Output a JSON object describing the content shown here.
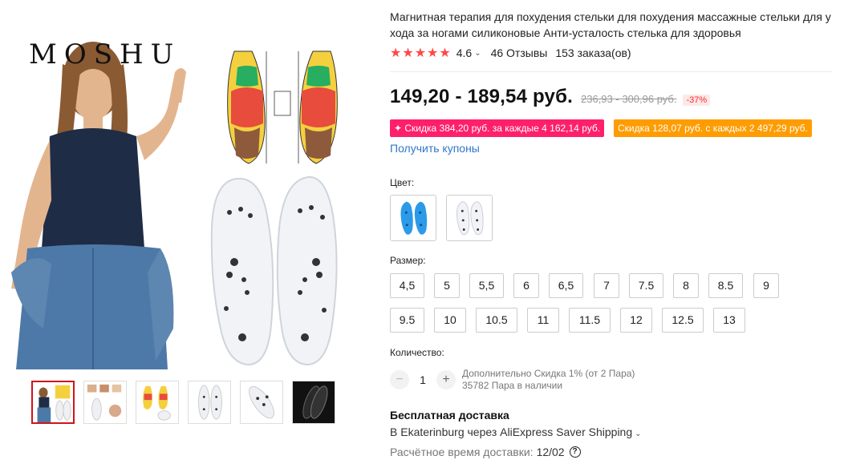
{
  "gallery": {
    "brand": "MOSHU",
    "thumbnails": [
      "thumb-1",
      "thumb-2",
      "thumb-3",
      "thumb-4",
      "thumb-5",
      "thumb-6"
    ],
    "active_thumbnail": 1
  },
  "product": {
    "title": "Магнитная терапия для похудения стельки для похудения массажные стельки для ухода за ногами силиконовые Анти-усталость стелька для здоровья",
    "rating": "4.6",
    "stars": "★★★★★",
    "reviews": "46 Отзывы",
    "orders": "153 заказа(ов)"
  },
  "pricing": {
    "price": "149,20 - 189,54 руб.",
    "old_price": "236,93 - 300,96 руб.",
    "discount": "-37%",
    "promo_pink": "✦ Скидка 384,20 руб. за каждые 4 162,14 руб.",
    "promo_orange": "Скидка 128,07 руб. с каждых 2 497,29 руб.",
    "coupons_link": "Получить купоны"
  },
  "color": {
    "label": "Цвет:",
    "options": [
      "blue-insoles",
      "clear-insoles"
    ]
  },
  "size": {
    "label": "Размер:",
    "row1": [
      "4,5",
      "5",
      "5,5",
      "6",
      "6,5",
      "7",
      "7.5",
      "8",
      "8.5",
      "9"
    ],
    "row2": [
      "9.5",
      "10",
      "10.5",
      "11",
      "11.5",
      "12",
      "12.5",
      "13"
    ]
  },
  "quantity": {
    "label": "Количество:",
    "minus": "−",
    "value": "1",
    "plus": "+",
    "note_line1": "Дополнительно Скидка 1% (от 2 Пара)",
    "note_line2": "35782 Пара в наличии"
  },
  "shipping": {
    "title": "Бесплатная доставка",
    "route": "В Ekaterinburg через AliExpress Saver Shipping",
    "caret": "⌄",
    "estimate_label": "Расчётное время доставки:",
    "estimate_date": "12/02",
    "help": "?"
  },
  "colors": {
    "accent_red": "#ff4747",
    "promo_pink": "#ff1f6b",
    "promo_orange": "#ff9c00",
    "link_blue": "#2f77c9"
  }
}
